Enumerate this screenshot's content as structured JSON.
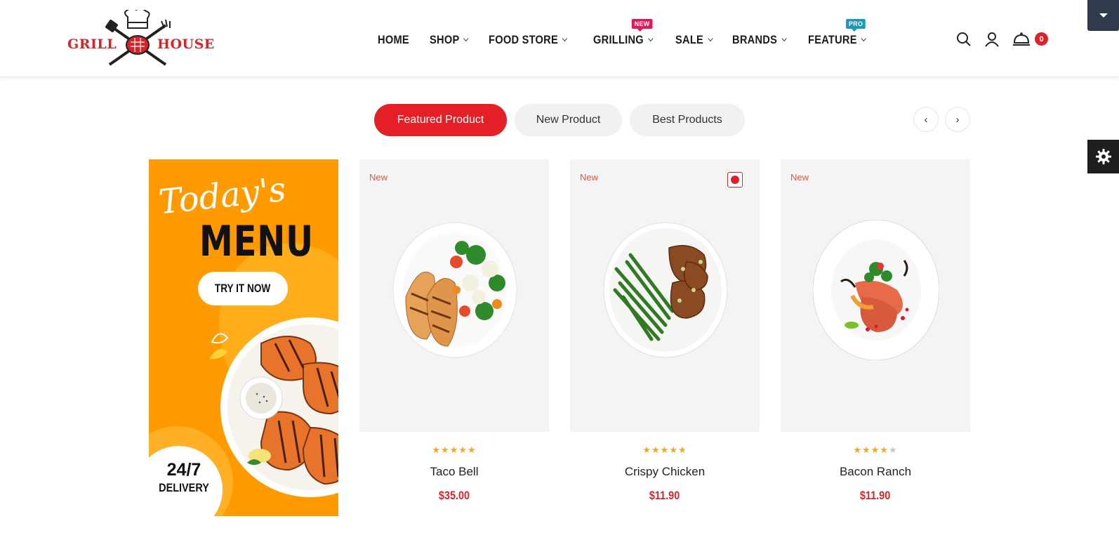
{
  "logo": {
    "left": "GRILL",
    "right": "HOUSE"
  },
  "nav": [
    {
      "label": "HOME",
      "dropdown": false
    },
    {
      "label": "SHOP",
      "dropdown": true
    },
    {
      "label": "FOOD STORE",
      "dropdown": true
    },
    {
      "label": "GRILLING",
      "dropdown": true,
      "badge": "NEW"
    },
    {
      "label": "SALE",
      "dropdown": true
    },
    {
      "label": "BRANDS",
      "dropdown": true
    },
    {
      "label": "FEATURE",
      "dropdown": true,
      "badge": "PRO"
    }
  ],
  "header_icons": [
    "search-icon",
    "user-icon",
    "cart-cloche-icon"
  ],
  "cart": {
    "count": "0"
  },
  "tabs": [
    {
      "label": "Featured Product",
      "active": true
    },
    {
      "label": "New Product",
      "active": false
    },
    {
      "label": "Best Products",
      "active": false
    }
  ],
  "arrows": {
    "prev": "‹",
    "next": "›"
  },
  "promo": {
    "script": "Today's",
    "title": "MENU",
    "button": "TRY IT NOW",
    "delivery_num": "24/7",
    "delivery_txt": "DELIVERY"
  },
  "products": [
    {
      "tag": "New",
      "name": "Taco Bell",
      "price": "$35.00",
      "rating": 5,
      "wishlisted": false
    },
    {
      "tag": "New",
      "name": "Crispy Chicken",
      "price": "$11.90",
      "rating": 5,
      "wishlisted": true
    },
    {
      "tag": "New",
      "name": "Bacon Ranch",
      "price": "$11.90",
      "rating": 4,
      "wishlisted": false
    }
  ],
  "colors": {
    "accent": "#e41f26",
    "promo_bg": "#ff9a00",
    "dark": "#2f3b4c",
    "star": "#f5a623",
    "badge_new": "#e0195b",
    "badge_pro": "#1a9ab8"
  }
}
